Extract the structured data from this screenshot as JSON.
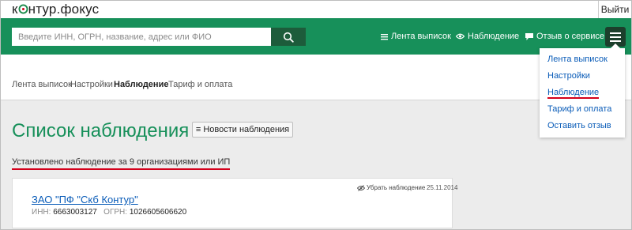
{
  "header": {
    "logo_part1": "к",
    "logo_part2": "нтур.фокус",
    "logout_label": "Выйти"
  },
  "search": {
    "placeholder": "Введите ИНН, ОГРН, название, адрес или ФИО"
  },
  "nav": {
    "feed_label": "Лента выписок",
    "watch_label": "Наблюдение",
    "feedback_label": "Отзыв о сервисе"
  },
  "subnav": {
    "items": [
      "Лента выписок",
      "Настройки",
      "Наблюдение",
      "Тариф и оплата"
    ],
    "active_index": 2
  },
  "dropdown": {
    "items": [
      "Лента выписок",
      "Настройки",
      "Наблюдение",
      "Тариф и оплата",
      "Оставить отзыв"
    ]
  },
  "main": {
    "title": "Список наблюдения",
    "news_button": "Новости наблюдения",
    "status_text": "Установлено наблюдение за 9 организациями или ИП"
  },
  "org": {
    "name": "ЗАО \"ПФ \"Скб Контур\"",
    "inn_label": "ИНН:",
    "inn": "6663003127",
    "ogrn_label": "ОГРН:",
    "ogrn": "1026605606620",
    "unwatch_label": "Убрать наблюдение",
    "date": "25.11.2014"
  },
  "colors": {
    "brand_green": "#17905a",
    "link_blue": "#0a5cb8",
    "highlight_red": "#d4001b"
  }
}
